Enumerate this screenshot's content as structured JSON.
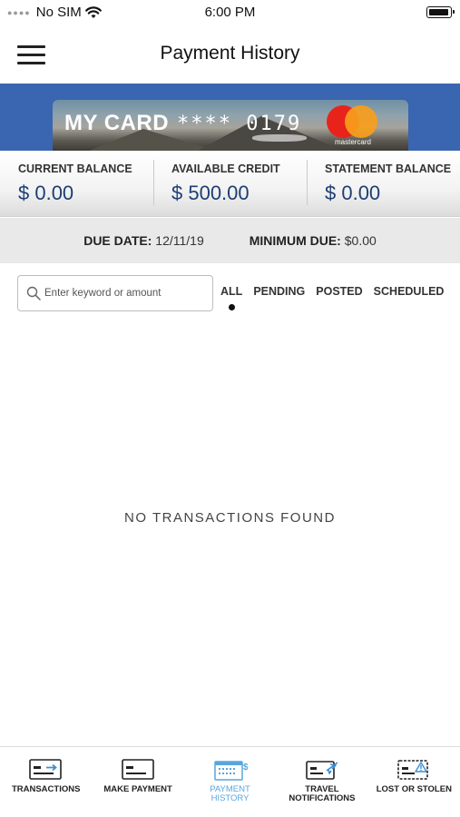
{
  "status_bar": {
    "carrier": "No SIM",
    "time": "6:00 PM",
    "wifi_icon": "wifi-icon",
    "battery_icon": "battery-icon"
  },
  "header": {
    "title": "Payment History",
    "menu_icon": "hamburger-menu-icon"
  },
  "card": {
    "name": "MY CARD",
    "masked_number": "**** 0179",
    "brand": "mastercard",
    "banner_color": "#3a65b0"
  },
  "balances": [
    {
      "label": "CURRENT BALANCE",
      "value": "$ 0.00"
    },
    {
      "label": "AVAILABLE CREDIT",
      "value": "$ 500.00"
    },
    {
      "label": "STATEMENT BALANCE",
      "value": "$ 0.00"
    }
  ],
  "due": {
    "due_date_label": "DUE DATE:",
    "due_date_value": "12/11/19",
    "minimum_due_label": "MINIMUM DUE:",
    "minimum_due_value": "$0.00"
  },
  "search": {
    "placeholder": "Enter keyword or amount",
    "value": ""
  },
  "filters": [
    {
      "label": "ALL",
      "active": true
    },
    {
      "label": "PENDING",
      "active": false
    },
    {
      "label": "POSTED",
      "active": false
    },
    {
      "label": "SCHEDULED",
      "active": false
    }
  ],
  "empty_message": "NO TRANSACTIONS FOUND",
  "tab_bar": {
    "active_color": "#5aa5de",
    "items": [
      {
        "label": "TRANSACTIONS",
        "icon": "card-arrow-icon",
        "active": false
      },
      {
        "label": "MAKE PAYMENT",
        "icon": "card-icon",
        "active": false
      },
      {
        "label": "PAYMENT\nHISTORY",
        "icon": "calendar-dollar-icon",
        "active": true
      },
      {
        "label": "TRAVEL\nNOTIFICATIONS",
        "icon": "card-plane-icon",
        "active": false
      },
      {
        "label": "LOST OR STOLEN",
        "icon": "card-warning-icon",
        "active": false
      }
    ]
  }
}
